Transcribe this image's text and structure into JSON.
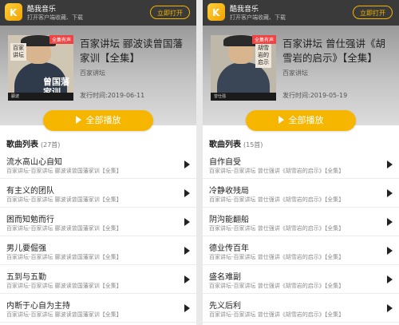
{
  "left": {
    "app": {
      "name": "酷我音乐",
      "sub": "打开客户端收藏、下载",
      "open_label": "立即打开"
    },
    "album": {
      "cover_tag": "全集有声",
      "cover_vtitle": "百家讲坛",
      "cover_big": "曾国藩家训",
      "cover_author": "郦波",
      "title": "百家讲坛 郦波读曾国藩家训【全集】",
      "artist": "百家讲坛",
      "date": "发行时间:2019-06-11"
    },
    "play_all": "全部播放",
    "list_title": "歌曲列表",
    "list_count": "(27首)",
    "songs": [
      {
        "title": "流水高山心自知",
        "meta": "百家讲坛-百家讲坛 郦波读曾国藩家训【全集】"
      },
      {
        "title": "有主义的团队",
        "meta": "百家讲坛-百家讲坛 郦波读曾国藩家训【全集】"
      },
      {
        "title": "困而知勉而行",
        "meta": "百家讲坛-百家讲坛 郦波读曾国藩家训【全集】"
      },
      {
        "title": "男儿要倔强",
        "meta": "百家讲坛-百家讲坛 郦波读曾国藩家训【全集】"
      },
      {
        "title": "五到与五勤",
        "meta": "百家讲坛-百家讲坛 郦波读曾国藩家训【全集】"
      },
      {
        "title": "内断于心自为主持",
        "meta": "百家讲坛-百家讲坛 郦波读曾国藩家训【全集】"
      }
    ]
  },
  "right": {
    "app": {
      "name": "酷我音乐",
      "sub": "打开客户端收藏、下载",
      "open_label": "立即打开"
    },
    "album": {
      "cover_tag": "全集有声",
      "cover_vtitle": "胡雪岩的启示",
      "cover_big": "",
      "cover_author": "曾仕强",
      "title": "百家讲坛 曾仕强讲《胡雪岩的启示》【全集】",
      "artist": "百家讲坛",
      "date": "发行时间:2019-05-19"
    },
    "play_all": "全部播放",
    "list_title": "歌曲列表",
    "list_count": "(15首)",
    "songs": [
      {
        "title": "自作自受",
        "meta": "百家讲坛-百家讲坛 曾仕强讲《胡雪岩的启示》【全集】"
      },
      {
        "title": "冷静收残局",
        "meta": "百家讲坛-百家讲坛 曾仕强讲《胡雪岩的启示》【全集】"
      },
      {
        "title": "阴沟能翻船",
        "meta": "百家讲坛-百家讲坛 曾仕强讲《胡雪岩的启示》【全集】"
      },
      {
        "title": "德业传百年",
        "meta": "百家讲坛-百家讲坛 曾仕强讲《胡雪岩的启示》【全集】"
      },
      {
        "title": "盛名难副",
        "meta": "百家讲坛-百家讲坛 曾仕强讲《胡雪岩的启示》【全集】"
      },
      {
        "title": "先义后利",
        "meta": "百家讲坛-百家讲坛 曾仕强讲《胡雪岩的启示》【全集】"
      }
    ]
  }
}
